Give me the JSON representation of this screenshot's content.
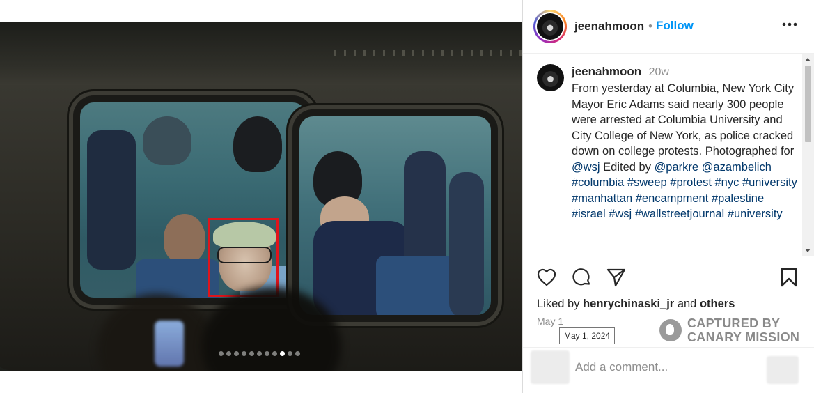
{
  "header": {
    "username": "jeenahmoon",
    "separator": "•",
    "follow_label": "Follow"
  },
  "caption": {
    "username": "jeenahmoon",
    "time_ago": "20w",
    "text_intro": "From yesterday at Columbia, New York City Mayor Eric Adams said nearly 300 people were arrested at Columbia University and City College of New York, as police cracked down on college protests. Photographed for ",
    "mention_wsj": "@wsj",
    "text_edited": " Edited by ",
    "mention_parkre": "@parkre",
    "mention_azambelich": "@azambelich",
    "hashtags": [
      "#columbia",
      "#sweep",
      "#protest",
      "#nyc",
      "#university",
      "#manhattan",
      "#encampment",
      "#palestine",
      "#israel",
      "#wsj",
      "#wallstreetjournal",
      "#university"
    ]
  },
  "carousel": {
    "total_slides": 11,
    "active_index": 8
  },
  "likes": {
    "prefix": "Liked by",
    "user": "henrychinaski_jr",
    "conjunction": "and",
    "others": "others"
  },
  "post_date": "May 1",
  "date_tooltip": "May 1, 2024",
  "watermark": {
    "line1": "CAPTURED BY",
    "line2": "CANARY MISSION"
  },
  "comment": {
    "placeholder": "Add a comment..."
  },
  "icons": {
    "like": "heart-icon",
    "comment": "comment-bubble-icon",
    "share": "paper-plane-icon",
    "save": "bookmark-icon",
    "more": "more-dots-icon"
  },
  "colors": {
    "accent": "#0095f6",
    "link": "#00376b",
    "highlight_box": "#e0141b"
  }
}
